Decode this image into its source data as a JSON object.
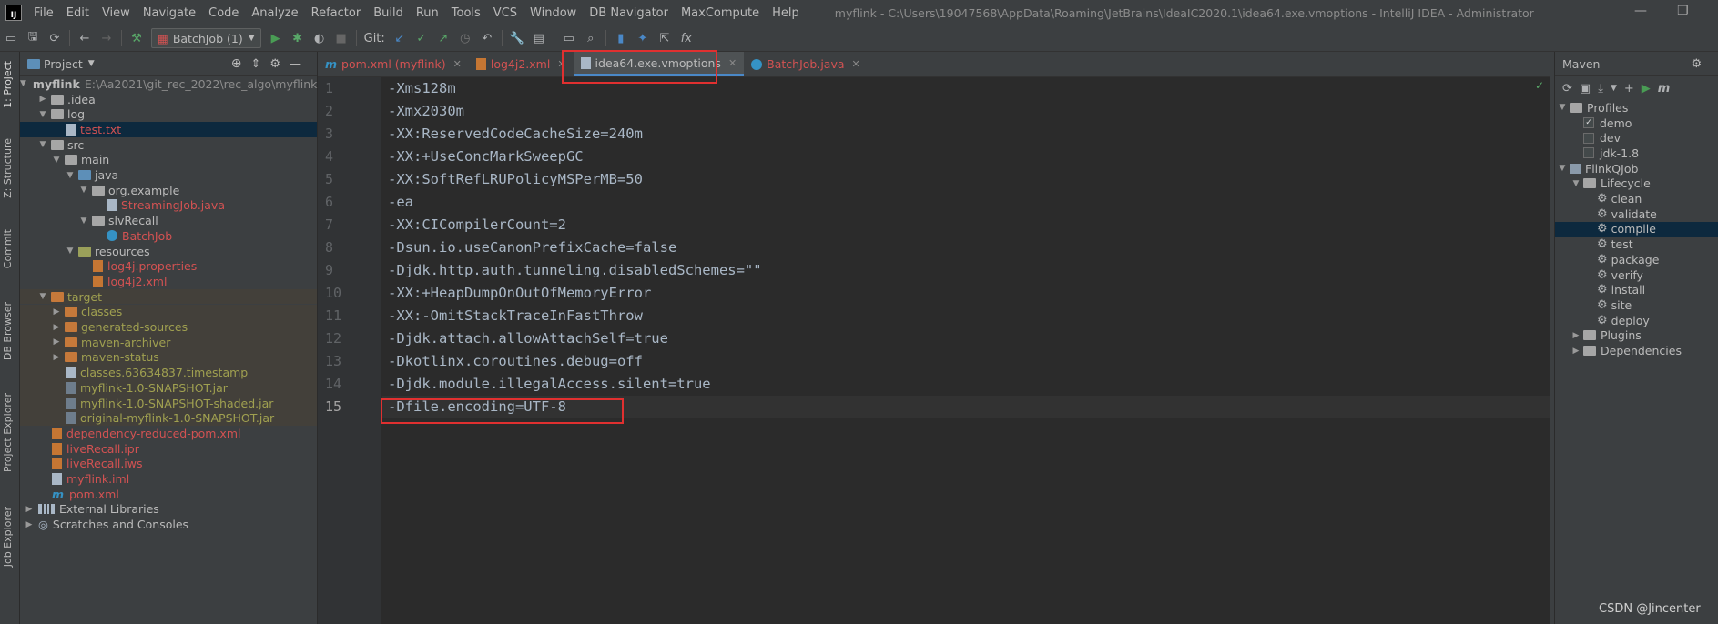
{
  "menubar": {
    "items": [
      "File",
      "Edit",
      "View",
      "Navigate",
      "Code",
      "Analyze",
      "Refactor",
      "Build",
      "Run",
      "Tools",
      "VCS",
      "Window",
      "DB Navigator",
      "MaxCompute",
      "Help"
    ],
    "title": "myflink - C:\\Users\\19047568\\AppData\\Roaming\\JetBrains\\IdeaIC2020.1\\idea64.exe.vmoptions - IntelliJ IDEA - Administrator"
  },
  "toolbar": {
    "run_config": "BatchJob (1)",
    "git_label": "Git:"
  },
  "left_strip": [
    "1: Project",
    "Z: Structure",
    "Commit",
    "DB Browser",
    "Project Explorer",
    "Job Explorer"
  ],
  "project": {
    "title": "Project",
    "tree": [
      {
        "label": "myflink",
        "path": "E:\\Aa2021\\git_rec_2022\\rec_algo\\myflink",
        "depth": 0,
        "arrow": "▼",
        "icon": "folder",
        "color": "normal",
        "bold": true
      },
      {
        "label": ".idea",
        "depth": 1,
        "arrow": "▶",
        "icon": "folder",
        "color": "normal"
      },
      {
        "label": "log",
        "depth": 1,
        "arrow": "▼",
        "icon": "folder",
        "color": "normal"
      },
      {
        "label": "test.txt",
        "depth": 2,
        "arrow": "",
        "icon": "file",
        "color": "red",
        "selected": true
      },
      {
        "label": "src",
        "depth": 1,
        "arrow": "▼",
        "icon": "folder",
        "color": "normal"
      },
      {
        "label": "main",
        "depth": 2,
        "arrow": "▼",
        "icon": "folder",
        "color": "normal"
      },
      {
        "label": "java",
        "depth": 3,
        "arrow": "▼",
        "icon": "folder-blue",
        "color": "normal"
      },
      {
        "label": "org.example",
        "depth": 4,
        "arrow": "▼",
        "icon": "folder",
        "color": "normal"
      },
      {
        "label": "StreamingJob.java",
        "depth": 5,
        "arrow": "",
        "icon": "file",
        "color": "red"
      },
      {
        "label": "slvRecall",
        "depth": 4,
        "arrow": "▼",
        "icon": "folder",
        "color": "normal"
      },
      {
        "label": "BatchJob",
        "depth": 5,
        "arrow": "",
        "icon": "class",
        "color": "red"
      },
      {
        "label": "resources",
        "depth": 3,
        "arrow": "▼",
        "icon": "folder-res",
        "color": "normal"
      },
      {
        "label": "log4j.properties",
        "depth": 4,
        "arrow": "",
        "icon": "file-red",
        "color": "red"
      },
      {
        "label": "log4j2.xml",
        "depth": 4,
        "arrow": "",
        "icon": "file-red",
        "color": "red"
      },
      {
        "label": "target",
        "depth": 1,
        "arrow": "▼",
        "icon": "folder-orange",
        "color": "olive",
        "excluded": true
      },
      {
        "label": "classes",
        "depth": 2,
        "arrow": "▶",
        "icon": "folder-orange",
        "color": "olive",
        "excluded": true
      },
      {
        "label": "generated-sources",
        "depth": 2,
        "arrow": "▶",
        "icon": "folder-orange",
        "color": "olive",
        "excluded": true
      },
      {
        "label": "maven-archiver",
        "depth": 2,
        "arrow": "▶",
        "icon": "folder-orange",
        "color": "olive",
        "excluded": true
      },
      {
        "label": "maven-status",
        "depth": 2,
        "arrow": "▶",
        "icon": "folder-orange",
        "color": "olive",
        "excluded": true
      },
      {
        "label": "classes.63634837.timestamp",
        "depth": 2,
        "arrow": "",
        "icon": "file",
        "color": "olive",
        "excluded": true
      },
      {
        "label": "myflink-1.0-SNAPSHOT.jar",
        "depth": 2,
        "arrow": "",
        "icon": "jar",
        "color": "olive",
        "excluded": true
      },
      {
        "label": "myflink-1.0-SNAPSHOT-shaded.jar",
        "depth": 2,
        "arrow": "",
        "icon": "jar",
        "color": "olive",
        "excluded": true
      },
      {
        "label": "original-myflink-1.0-SNAPSHOT.jar",
        "depth": 2,
        "arrow": "",
        "icon": "jar",
        "color": "olive",
        "excluded": true
      },
      {
        "label": "dependency-reduced-pom.xml",
        "depth": 1,
        "arrow": "",
        "icon": "file-red",
        "color": "red"
      },
      {
        "label": "liveRecall.ipr",
        "depth": 1,
        "arrow": "",
        "icon": "file-red",
        "color": "red"
      },
      {
        "label": "liveRecall.iws",
        "depth": 1,
        "arrow": "",
        "icon": "file-red",
        "color": "red"
      },
      {
        "label": "myflink.iml",
        "depth": 1,
        "arrow": "",
        "icon": "file",
        "color": "red"
      },
      {
        "label": "pom.xml",
        "depth": 1,
        "arrow": "",
        "icon": "maven",
        "color": "red"
      },
      {
        "label": "External Libraries",
        "depth": 0,
        "arrow": "▶",
        "icon": "lib",
        "color": "normal"
      },
      {
        "label": "Scratches and Consoles",
        "depth": 0,
        "arrow": "▶",
        "icon": "scratch",
        "color": "normal"
      }
    ]
  },
  "editor": {
    "tabs": [
      {
        "label": "pom.xml (myflink)",
        "color": "#d25252",
        "icon": "m"
      },
      {
        "label": "log4j2.xml",
        "color": "#d25252",
        "icon": "file"
      },
      {
        "label": "idea64.exe.vmoptions",
        "color": "#bbbbbb",
        "icon": "file",
        "active": true
      },
      {
        "label": "BatchJob.java",
        "color": "#d25252",
        "icon": "class"
      }
    ],
    "lines": [
      "-Xms128m",
      "-Xmx2030m",
      "-XX:ReservedCodeCacheSize=240m",
      "-XX:+UseConcMarkSweepGC",
      "-XX:SoftRefLRUPolicyMSPerMB=50",
      "-ea",
      "-XX:CICompilerCount=2",
      "-Dsun.io.useCanonPrefixCache=false",
      "-Djdk.http.auth.tunneling.disabledSchemes=\"\"",
      "-XX:+HeapDumpOnOutOfMemoryError",
      "-XX:-OmitStackTraceInFastThrow",
      "-Djdk.attach.allowAttachSelf=true",
      "-Dkotlinx.coroutines.debug=off",
      "-Djdk.module.illegalAccess.silent=true",
      "-Dfile.encoding=UTF-8"
    ]
  },
  "maven": {
    "title": "Maven",
    "tree": [
      {
        "label": "Profiles",
        "depth": 0,
        "arrow": "▼",
        "icon": "folder"
      },
      {
        "label": "demo",
        "depth": 1,
        "arrow": "",
        "icon": "checkbox",
        "checked": true
      },
      {
        "label": "dev",
        "depth": 1,
        "arrow": "",
        "icon": "checkbox",
        "checked": false
      },
      {
        "label": "jdk-1.8",
        "depth": 1,
        "arrow": "",
        "icon": "checkbox",
        "checked": false
      },
      {
        "label": "FlinkQJob",
        "depth": 0,
        "arrow": "▼",
        "icon": "module"
      },
      {
        "label": "Lifecycle",
        "depth": 1,
        "arrow": "▼",
        "icon": "folder"
      },
      {
        "label": "clean",
        "depth": 2,
        "arrow": "",
        "icon": "gear"
      },
      {
        "label": "validate",
        "depth": 2,
        "arrow": "",
        "icon": "gear"
      },
      {
        "label": "compile",
        "depth": 2,
        "arrow": "",
        "icon": "gear",
        "selected": true
      },
      {
        "label": "test",
        "depth": 2,
        "arrow": "",
        "icon": "gear"
      },
      {
        "label": "package",
        "depth": 2,
        "arrow": "",
        "icon": "gear"
      },
      {
        "label": "verify",
        "depth": 2,
        "arrow": "",
        "icon": "gear"
      },
      {
        "label": "install",
        "depth": 2,
        "arrow": "",
        "icon": "gear"
      },
      {
        "label": "site",
        "depth": 2,
        "arrow": "",
        "icon": "gear"
      },
      {
        "label": "deploy",
        "depth": 2,
        "arrow": "",
        "icon": "gear"
      },
      {
        "label": "Plugins",
        "depth": 1,
        "arrow": "▶",
        "icon": "folder"
      },
      {
        "label": "Dependencies",
        "depth": 1,
        "arrow": "▶",
        "icon": "folder"
      }
    ]
  },
  "watermark": "CSDN @Jincenter",
  "colors": {
    "accent": "#4a88c7",
    "highlight": "#e03030",
    "selection": "#0d293e"
  }
}
